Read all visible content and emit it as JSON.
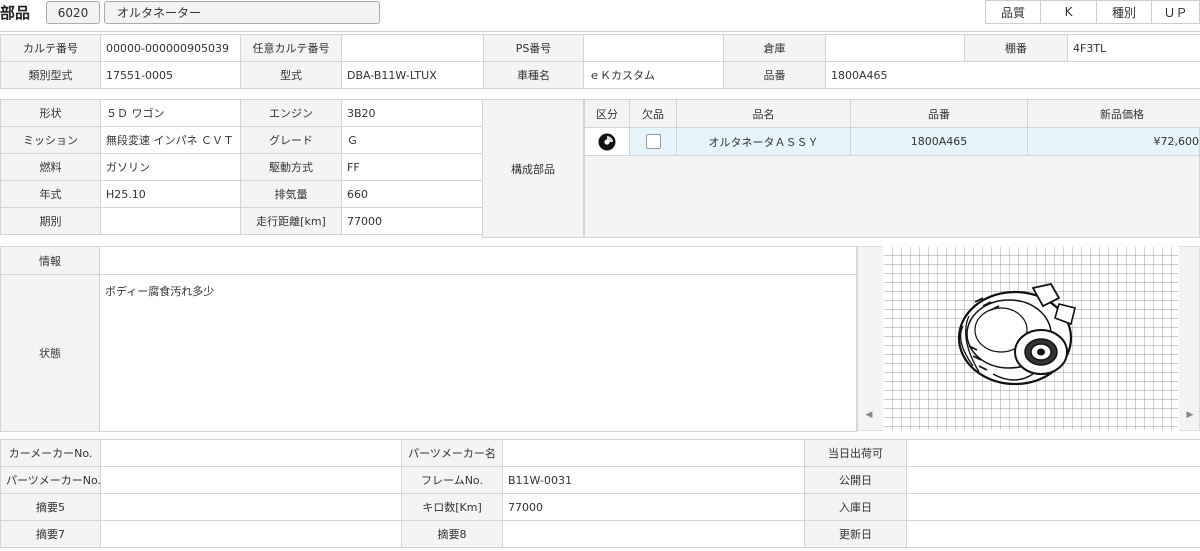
{
  "header": {
    "title": "部品",
    "code": "6020",
    "name": "オルタネーター",
    "buttons": [
      "品質",
      "K",
      "種別",
      "ＵＰ"
    ]
  },
  "row1": {
    "karte_label": "カルテ番号",
    "karte_value": "00000-000000905039",
    "nini_label": "任意カルテ番号",
    "nini_value": "",
    "ps_label": "PS番号",
    "ps_value": "",
    "soko_label": "倉庫",
    "soko_value": "",
    "tana_label": "棚番",
    "tana_value": "4F3TL"
  },
  "row2": {
    "ruibetsu_label": "類別型式",
    "ruibetsu_value": "17551-0005",
    "kata_label": "型式",
    "kata_value": "DBA-B11W-LTUX",
    "shamei_label": "車種名",
    "shamei_value": "ｅＫカスタム",
    "hinban_label": "品番",
    "hinban_value": "1800A465"
  },
  "spec": {
    "rows": [
      {
        "l1": "形状",
        "v1": "５Ｄ ワゴン",
        "l2": "エンジン",
        "v2": "3B20"
      },
      {
        "l1": "ミッション",
        "v1": "無段変速 インパネ ＣＶＴ",
        "l2": "グレード",
        "v2": "Ｇ"
      },
      {
        "l1": "燃料",
        "v1": "ガソリン",
        "l2": "駆動方式",
        "v2": "FF"
      },
      {
        "l1": "年式",
        "v1": "H25.10",
        "l2": "排気量",
        "v2": "660"
      },
      {
        "l1": "期別",
        "v1": "",
        "l2": "走行距離[km]",
        "v2": "77000"
      }
    ],
    "kosei_label": "構成部品"
  },
  "parts_table": {
    "headers": [
      "区分",
      "欠品",
      "品名",
      "品番",
      "新品価格"
    ],
    "rows": [
      {
        "name": "オルタネータＡＳＳＹ",
        "number": "1800A465",
        "price": "¥72,600",
        "missing": false
      }
    ]
  },
  "info": {
    "joho_label": "情報",
    "joho_value": "",
    "jotai_label": "状態",
    "jotai_value": "ボディー腐食汚れ多少"
  },
  "image_viewer": {
    "left_arrow": "◀",
    "right_arrow": "▶"
  },
  "bottom": {
    "rows": [
      {
        "l1": "カーメーカーNo.",
        "v1": "",
        "l2": "パーツメーカー名",
        "v2": "",
        "l3": "当日出荷可",
        "v3": ""
      },
      {
        "l1": "パーツメーカーNo.",
        "v1": "",
        "l2": "フレームNo.",
        "v2": "B11W-0031",
        "l3": "公開日",
        "v3": ""
      },
      {
        "l1": "摘要5",
        "v1": "",
        "l2": "キロ数[Km]",
        "v2": "77000",
        "l3": "入庫日",
        "v3": ""
      },
      {
        "l1": "摘要7",
        "v1": "",
        "l2": "摘要8",
        "v2": "",
        "l3": "更新日",
        "v3": ""
      }
    ]
  }
}
